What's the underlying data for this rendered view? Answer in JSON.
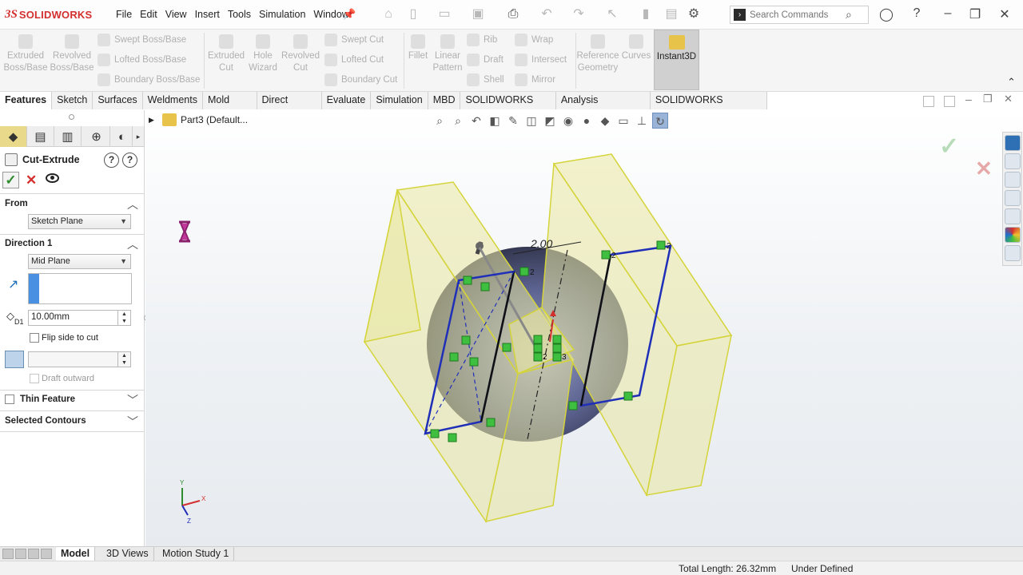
{
  "app": {
    "brand": "SOLIDWORKS",
    "brand_mark": "3S"
  },
  "menu": [
    "File",
    "Edit",
    "View",
    "Insert",
    "Tools",
    "Simulation",
    "Window"
  ],
  "search": {
    "placeholder": "Search Commands"
  },
  "toolbar": {
    "extruded_boss": "Extruded Boss/Base",
    "revolved_boss": "Revolved Boss/Base",
    "swept_boss": "Swept Boss/Base",
    "lofted_boss": "Lofted Boss/Base",
    "boundary_boss": "Boundary Boss/Base",
    "extruded_cut": "Extruded Cut",
    "hole_wizard": "Hole Wizard",
    "revolved_cut": "Revolved Cut",
    "swept_cut": "Swept Cut",
    "lofted_cut": "Lofted Cut",
    "boundary_cut": "Boundary Cut",
    "fillet": "Fillet",
    "linear_pattern": "Linear Pattern",
    "rib": "Rib",
    "draft": "Draft",
    "shell": "Shell",
    "wrap": "Wrap",
    "intersect": "Intersect",
    "mirror": "Mirror",
    "reference_geometry": "Reference Geometry",
    "curves": "Curves",
    "instant3d": "Instant3D"
  },
  "tabs": [
    "Features",
    "Sketch",
    "Surfaces",
    "Weldments",
    "Mold Tools",
    "Direct Editing",
    "Evaluate",
    "Simulation",
    "MBD",
    "SOLIDWORKS CAM",
    "Analysis Preparation",
    "SOLIDWORKS Inspection"
  ],
  "active_tab": "Features",
  "property_manager": {
    "title": "Cut-Extrude",
    "help": "?",
    "from": {
      "label": "From",
      "value": "Sketch Plane"
    },
    "direction1": {
      "label": "Direction 1",
      "end_condition": "Mid Plane",
      "depth": "10.00mm",
      "depth_icon_label": "D1",
      "flip_side_label": "Flip side to cut",
      "flip_side_checked": false,
      "draft_outward_label": "Draft outward",
      "draft_outward_checked": false
    },
    "thin_feature": {
      "label": "Thin Feature",
      "checked": false
    },
    "selected_contours": {
      "label": "Selected Contours"
    }
  },
  "tree": {
    "part_name": "Part3 (Default..."
  },
  "viewport": {
    "dimension_label": "2.00",
    "relation_labels": [
      "2",
      "2",
      "2",
      "2",
      "3"
    ],
    "triad": {
      "x": "X",
      "y": "Y",
      "z": "Z"
    }
  },
  "model_tabs": [
    "Model",
    "3D Views",
    "Motion Study 1"
  ],
  "active_model_tab": "Model",
  "status": {
    "total_length": "Total Length: 26.32mm",
    "state": "Under Defined"
  },
  "colors": {
    "brand_red": "#d32f2f",
    "body_yellow": "#e9e7a3",
    "sketch_blue": "#1f2fb8",
    "relation_green": "#3fbf3f"
  }
}
